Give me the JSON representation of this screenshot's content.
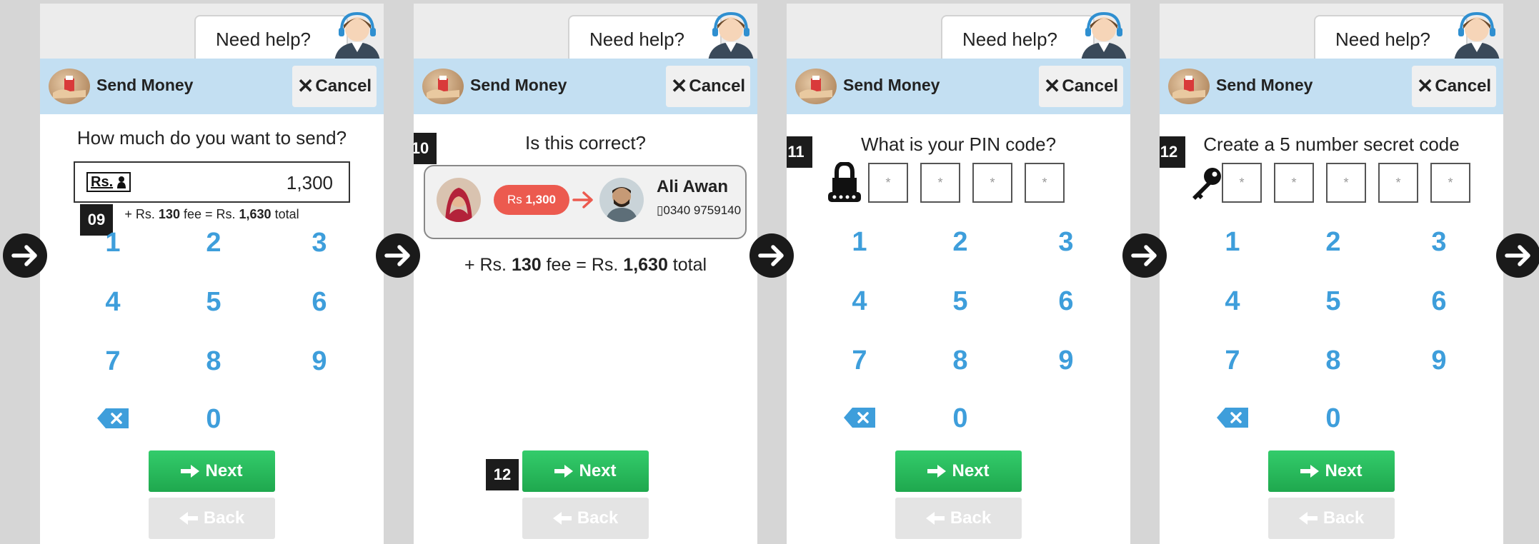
{
  "help_label": "Need help?",
  "app_title": "Send Money",
  "cancel_label": "Cancel",
  "next_label": "Next",
  "back_label": "Back",
  "keypad_keys": [
    "1",
    "2",
    "3",
    "4",
    "5",
    "6",
    "7",
    "8",
    "9",
    "0"
  ],
  "colors": {
    "title_bar": "#c3dff2",
    "key_blue": "#3e9edb",
    "next_green": "#2bbd5f",
    "back_gray": "#e4e4e4",
    "amount_pill": "#ec5a4f"
  },
  "icons": [
    "agent-headset-icon",
    "send-money-icon",
    "close-icon",
    "backspace-icon",
    "arrow-right-icon",
    "arrow-left-icon",
    "lock-icon",
    "key-icon",
    "flow-arrow-icon",
    "rupee-person-icon"
  ],
  "screens": [
    {
      "step": "09",
      "question": "How much do you want to send?",
      "currency_label": "Rs.",
      "amount": "1,300",
      "fee": {
        "prefix": "+ Rs. ",
        "fee_amount": "130",
        "middle": " fee = Rs. ",
        "total": "1,630",
        "suffix": " total"
      }
    },
    {
      "step": "10",
      "question": "Is this correct?",
      "pill_amount_prefix": "Rs ",
      "pill_amount": "1,300",
      "recipient_name": "Ali Awan",
      "recipient_phone": "0340 9759140",
      "fee": {
        "prefix": "+ Rs. ",
        "fee_amount": "130",
        "middle": " fee = Rs. ",
        "total": "1,630",
        "suffix": " total"
      },
      "next_step": "12"
    },
    {
      "step": "11",
      "question": "What is your PIN code?",
      "pin_placeholder": "*"
    },
    {
      "step": "12",
      "question": "Create a 5 number secret code",
      "code_placeholder": "*"
    }
  ]
}
